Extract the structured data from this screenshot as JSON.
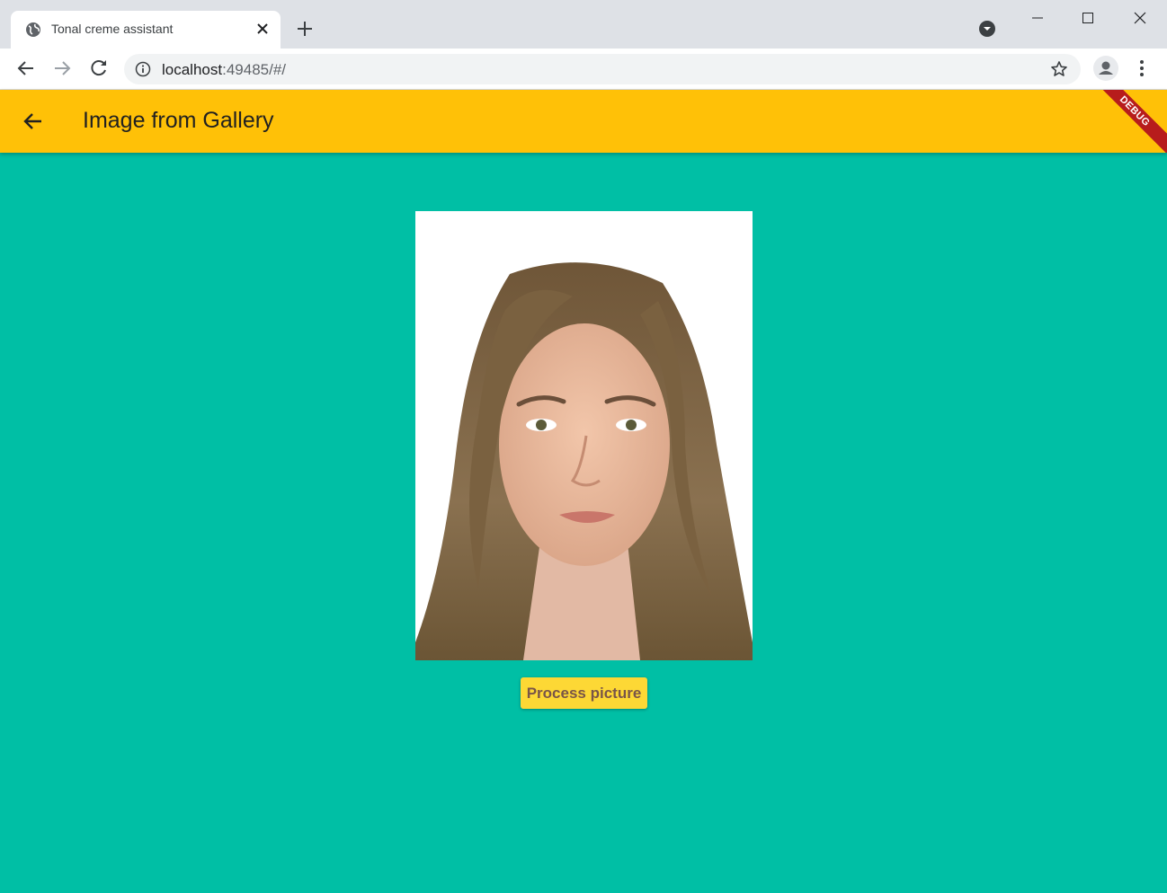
{
  "browser": {
    "tab_title": "Tonal creme assistant",
    "url_host": "localhost",
    "url_rest": ":49485/#/"
  },
  "app": {
    "title": "Image from Gallery",
    "debug_label": "DEBUG",
    "process_button_label": "Process picture",
    "app_bar_color": "#ffc107",
    "background_color": "#00bfa5",
    "button_color": "#fdd835"
  },
  "icons": {
    "tab_favicon": "globe-icon",
    "tab_close": "close-icon",
    "new_tab": "plus-icon",
    "profile_menu": "chevron-down-circle-icon",
    "back": "arrow-left-icon",
    "forward": "arrow-right-icon",
    "reload": "reload-icon",
    "info": "info-icon",
    "star": "star-icon",
    "account": "account-icon",
    "more": "more-vert-icon",
    "appbar_back": "arrow-left-icon"
  }
}
